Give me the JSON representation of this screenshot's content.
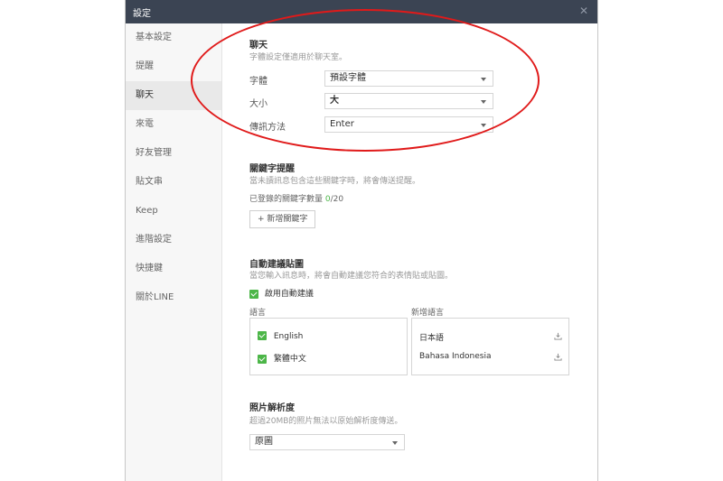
{
  "window": {
    "title": "設定"
  },
  "sidebar": {
    "items": [
      {
        "label": "基本設定"
      },
      {
        "label": "提醒"
      },
      {
        "label": "聊天"
      },
      {
        "label": "來電"
      },
      {
        "label": "好友管理"
      },
      {
        "label": "貼文串"
      },
      {
        "label": "Keep"
      },
      {
        "label": "進階設定"
      },
      {
        "label": "快捷鍵"
      },
      {
        "label": "關於LINE"
      }
    ],
    "active_index": 2
  },
  "chat": {
    "heading": "聊天",
    "description": "字體設定僅適用於聊天室。",
    "font_label": "字體",
    "font_value": "預設字體",
    "size_label": "大小",
    "size_value": "大",
    "send_label": "傳訊方法",
    "send_value": "Enter"
  },
  "keyword": {
    "heading": "關鍵字提醒",
    "description": "當未讀訊息包含這些關鍵字時，將會傳送提醒。",
    "count_label": "已登錄的關鍵字數量",
    "count_current": "0",
    "count_max": "/20",
    "add_button": "新增關鍵字"
  },
  "sticker": {
    "heading": "自動建議貼圖",
    "description": "當您輸入訊息時，將會自動建議您符合的表情貼或貼圖。",
    "enable_label": "啟用自動建議",
    "languages_header": "語言",
    "add_languages_header": "新增語言",
    "languages": [
      "English",
      "繁體中文"
    ],
    "add_languages": [
      "日本語",
      "Bahasa Indonesia"
    ]
  },
  "photo": {
    "heading": "照片解析度",
    "description": "超過20MB的照片無法以原始解析度傳送。",
    "value": "原圖"
  },
  "colors": {
    "titlebar": "#3b4453",
    "accent_green": "#4cb648",
    "annotation": "#e01a1a"
  }
}
